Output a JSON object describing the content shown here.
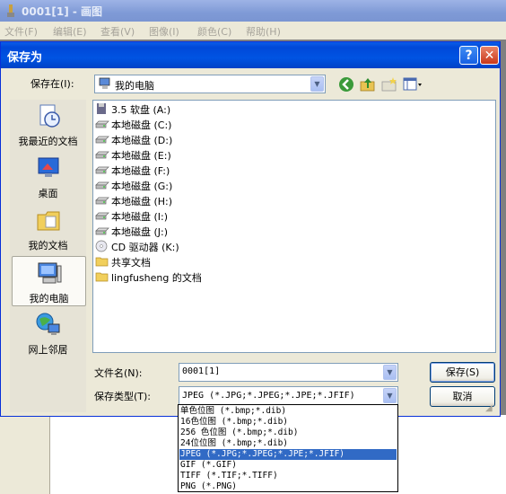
{
  "app": {
    "title": "0001[1] - 画图",
    "menu": [
      "文件(F)",
      "编辑(E)",
      "查看(V)",
      "图像(I)",
      "颜色(C)",
      "帮助(H)"
    ]
  },
  "dialog": {
    "title": "保存为",
    "help_label": "?",
    "close_label": "✕",
    "save_in_label": "保存在(I):",
    "save_in_value": "我的电脑",
    "places": [
      {
        "label": "我最近的文档",
        "icon": "recent-documents-icon"
      },
      {
        "label": "桌面",
        "icon": "desktop-icon"
      },
      {
        "label": "我的文档",
        "icon": "my-documents-icon"
      },
      {
        "label": "我的电脑",
        "icon": "my-computer-icon"
      },
      {
        "label": "网上邻居",
        "icon": "network-places-icon"
      }
    ],
    "files": [
      {
        "label": "3.5 软盘 (A:)",
        "icon": "floppy-drive-icon"
      },
      {
        "label": "本地磁盘 (C:)",
        "icon": "hard-drive-icon"
      },
      {
        "label": "本地磁盘 (D:)",
        "icon": "hard-drive-icon"
      },
      {
        "label": "本地磁盘 (E:)",
        "icon": "hard-drive-icon"
      },
      {
        "label": "本地磁盘 (F:)",
        "icon": "hard-drive-icon"
      },
      {
        "label": "本地磁盘 (G:)",
        "icon": "hard-drive-icon"
      },
      {
        "label": "本地磁盘 (H:)",
        "icon": "hard-drive-icon"
      },
      {
        "label": "本地磁盘 (I:)",
        "icon": "hard-drive-icon"
      },
      {
        "label": "本地磁盘 (J:)",
        "icon": "hard-drive-icon"
      },
      {
        "label": "CD 驱动器 (K:)",
        "icon": "cd-drive-icon"
      },
      {
        "label": "共享文档",
        "icon": "folder-icon"
      },
      {
        "label": "lingfusheng 的文档",
        "icon": "folder-icon"
      }
    ],
    "filename_label": "文件名(N):",
    "filename_value": "0001[1]",
    "filetype_label": "保存类型(T):",
    "filetype_value": "JPEG (*.JPG;*.JPEG;*.JPE;*.JFIF)",
    "save_button": "保存(S)",
    "cancel_button": "取消",
    "filetype_options": [
      "单色位图 (*.bmp;*.dib)",
      "16色位图 (*.bmp;*.dib)",
      "256 色位图 (*.bmp;*.dib)",
      "24位位图 (*.bmp;*.dib)",
      "JPEG (*.JPG;*.JPEG;*.JPE;*.JFIF)",
      "GIF (*.GIF)",
      "TIFF (*.TIF;*.TIFF)",
      "PNG (*.PNG)"
    ],
    "selected_filetype_index": 4
  },
  "colors": {
    "title_active": "#0054e3",
    "title_inactive": "#7f9ad6",
    "dialog_face": "#ece9d8",
    "selection": "#316ac5"
  }
}
